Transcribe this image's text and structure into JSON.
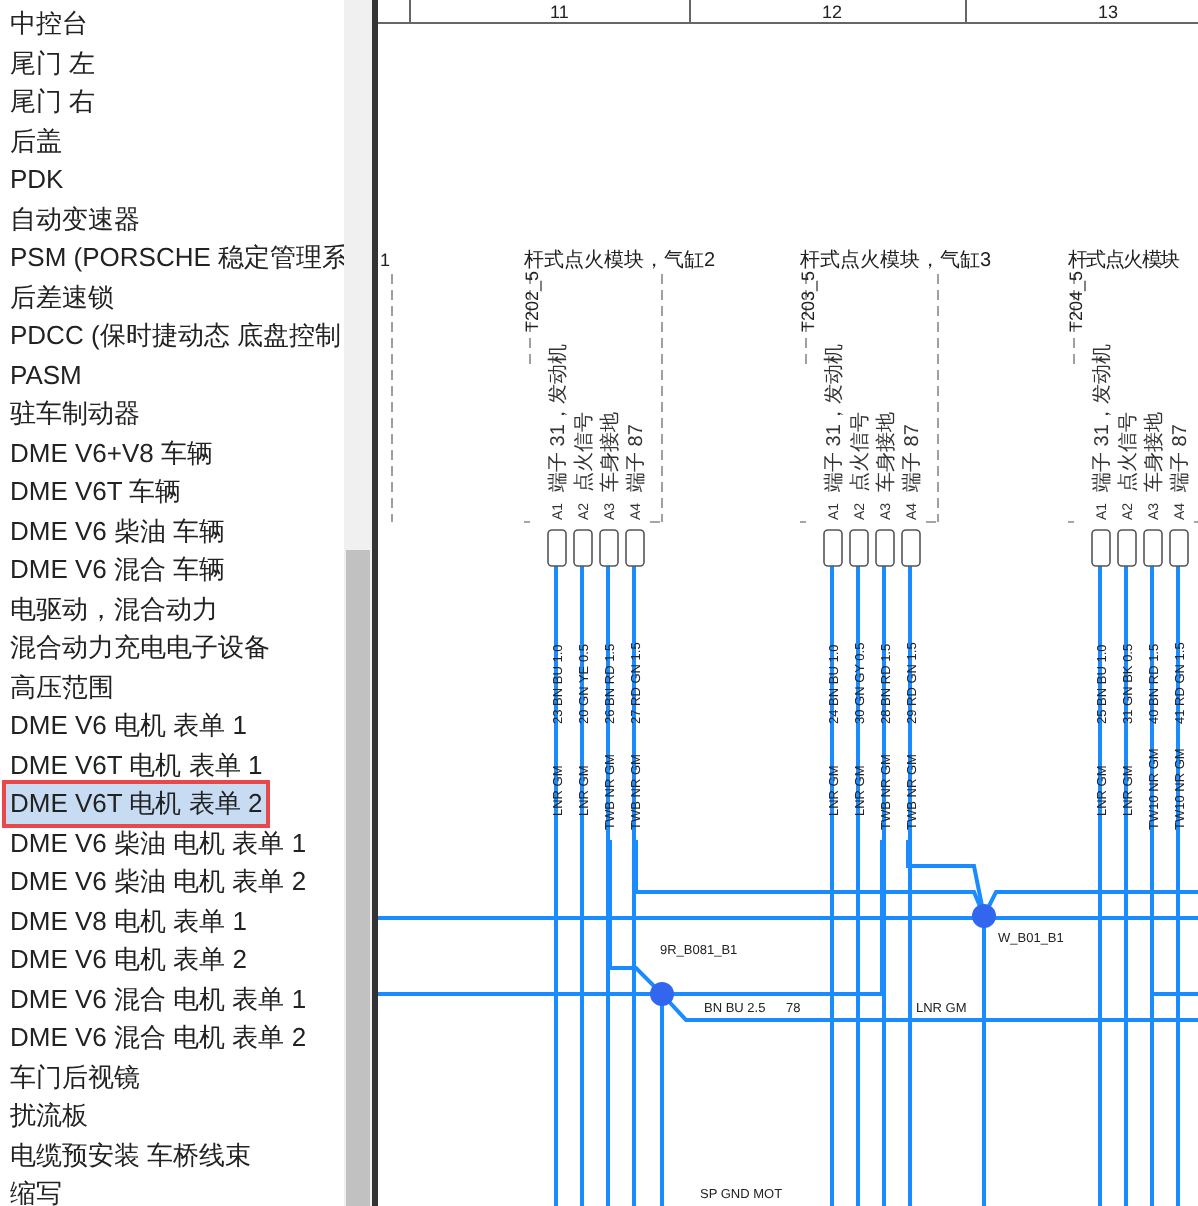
{
  "sidebar": {
    "items": [
      {
        "label": "中控台",
        "selected": false
      },
      {
        "label": "尾门 左",
        "selected": false
      },
      {
        "label": "尾门 右",
        "selected": false
      },
      {
        "label": "后盖",
        "selected": false
      },
      {
        "label": "PDK",
        "selected": false
      },
      {
        "label": "自动变速器",
        "selected": false
      },
      {
        "label": "PSM (PORSCHE 稳定管理系",
        "selected": false
      },
      {
        "label": "后差速锁",
        "selected": false
      },
      {
        "label": "PDCC (保时捷动态 底盘控制",
        "selected": false
      },
      {
        "label": "PASM",
        "selected": false
      },
      {
        "label": "驻车制动器",
        "selected": false
      },
      {
        "label": "DME V6+V8 车辆",
        "selected": false
      },
      {
        "label": "DME V6T 车辆",
        "selected": false
      },
      {
        "label": "DME V6 柴油 车辆",
        "selected": false
      },
      {
        "label": "DME V6 混合 车辆",
        "selected": false
      },
      {
        "label": "电驱动，混合动力",
        "selected": false
      },
      {
        "label": "混合动力充电电子设备",
        "selected": false
      },
      {
        "label": "高压范围",
        "selected": false
      },
      {
        "label": "DME V6 电机 表单 1",
        "selected": false
      },
      {
        "label": "DME V6T 电机 表单 1",
        "selected": false
      },
      {
        "label": "DME V6T 电机 表单 2",
        "selected": true
      },
      {
        "label": "DME V6 柴油 电机 表单 1",
        "selected": false
      },
      {
        "label": "DME V6 柴油 电机 表单 2",
        "selected": false
      },
      {
        "label": "DME V8 电机 表单 1",
        "selected": false
      },
      {
        "label": "DME V6 电机 表单 2",
        "selected": false
      },
      {
        "label": "DME V6 混合 电机 表单 1",
        "selected": false
      },
      {
        "label": "DME V6 混合 电机 表单 2",
        "selected": false
      },
      {
        "label": "车门后视镜",
        "selected": false
      },
      {
        "label": "扰流板",
        "selected": false
      },
      {
        "label": "电缆预安装 车桥线束",
        "selected": false
      },
      {
        "label": "缩写",
        "selected": false
      }
    ]
  },
  "diagram": {
    "columns": [
      "11",
      "12",
      "13"
    ],
    "left_module_title": "1",
    "modules": [
      {
        "title": "杆式点火模块，气缸2",
        "connector": "T202_5",
        "terminals": [
          "端子 31，发动机",
          "点火信号",
          "车身接地",
          "端子 87"
        ],
        "pins": [
          "A1",
          "A2",
          "A3",
          "A4"
        ],
        "wires": [
          {
            "code": "23 BN BU 1.0",
            "harness": "LNR GM"
          },
          {
            "code": "20 GN YE 0.5",
            "harness": "LNR GM"
          },
          {
            "code": "26 BN RD 1.5",
            "harness": "TWB NR GM"
          },
          {
            "code": "27 RD GN 1.5",
            "harness": "TWB NR GM"
          }
        ]
      },
      {
        "title": "杆式点火模块，气缸3",
        "connector": "T203_5",
        "terminals": [
          "端子 31，发动机",
          "点火信号",
          "车身接地",
          "端子 87"
        ],
        "pins": [
          "A1",
          "A2",
          "A3",
          "A4"
        ],
        "wires": [
          {
            "code": "24 BN BU 1.0",
            "harness": "LNR GM"
          },
          {
            "code": "30 GN GY 0.5",
            "harness": "LNR GM"
          },
          {
            "code": "28 BN RD 1.5",
            "harness": "TWB NR GM"
          },
          {
            "code": "29 RD GN 1.5",
            "harness": "TWB NR GM"
          }
        ]
      },
      {
        "title": "杆式点火模块",
        "connector": "T204_5",
        "terminals": [
          "端子 31，发动机",
          "点火信号",
          "车身接地",
          "端子 87"
        ],
        "pins": [
          "A1",
          "A2",
          "A3",
          "A4"
        ],
        "wires": [
          {
            "code": "25 BN BU 1.0",
            "harness": "LNR GM"
          },
          {
            "code": "31 GN BK 0.5",
            "harness": "LNR GM"
          },
          {
            "code": "40 BN RD 1.5",
            "harness": "TW10 NR GM"
          },
          {
            "code": "41 RD GN 1.5",
            "harness": "TW10 NR GM"
          }
        ]
      }
    ],
    "junctions": [
      "9R_B081_B1",
      "W_B01_B1"
    ],
    "wire_labels": [
      "BN BU 2.5",
      "78",
      "LNR GM",
      "SP GND MOT"
    ]
  }
}
